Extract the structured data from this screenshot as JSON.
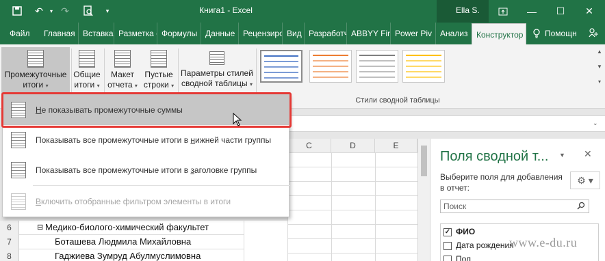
{
  "window": {
    "title": "Книга1  -  Excel",
    "user": "Ella S.",
    "icons": [
      "save-icon",
      "undo-icon",
      "redo-icon",
      "print-preview-icon",
      "customize-qat-icon",
      "minimize-icon",
      "maximize-icon",
      "close-icon"
    ]
  },
  "tabs": [
    {
      "label": "Файл"
    },
    {
      "label": "Главная"
    },
    {
      "label": "Вставка"
    },
    {
      "label": "Разметка с"
    },
    {
      "label": "Формулы"
    },
    {
      "label": "Данные"
    },
    {
      "label": "Рецензиро"
    },
    {
      "label": "Вид"
    },
    {
      "label": "Разработч"
    },
    {
      "label": "ABBYY Fin"
    },
    {
      "label": "Power Piv"
    },
    {
      "label": "Анализ"
    },
    {
      "label": "Конструктор",
      "active": true
    },
    {
      "label": "Помощн"
    }
  ],
  "ribbon": {
    "subtotals": {
      "line1": "Промежуточные",
      "line2": "итоги"
    },
    "grand_totals": {
      "line1": "Общие",
      "line2": "итоги"
    },
    "report_layout": {
      "line1": "Макет",
      "line2": "отчета"
    },
    "blank_rows": {
      "line1": "Пустые",
      "line2": "строки"
    },
    "style_options": {
      "line1": "Параметры стилей",
      "line2": "сводной таблицы"
    },
    "styles_group_label": "Стили сводной таблицы",
    "accent_colors": [
      "#4472c4",
      "#ed7d31",
      "#ffc000"
    ]
  },
  "menu": {
    "items": [
      {
        "pre": "",
        "u": "Н",
        "post": "е показывать промежуточные суммы",
        "highlighted": true
      },
      {
        "pre": "Показывать все промежуточные итоги в ",
        "u": "н",
        "post": "ижней части группы"
      },
      {
        "pre": "Показывать все промежуточные итоги в ",
        "u": "з",
        "post": "аголовке группы"
      },
      {
        "pre": "",
        "u": "В",
        "post": "ключить отобранные фильтром элементы в итоги",
        "disabled": true
      }
    ]
  },
  "grid": {
    "columns": [
      "C",
      "D",
      "E"
    ],
    "rows": [
      {
        "num": "6",
        "text": "Медико-биолого-химический факультет",
        "collapse": "⊟"
      },
      {
        "num": "7",
        "text": "Боташева Людмила Михайловна"
      },
      {
        "num": "8",
        "text": "Гаджиева Зумруд Абулмуслимовна"
      }
    ]
  },
  "pane": {
    "title": "Поля сводной т...",
    "hint": "Выберите поля для добавления в отчет:",
    "search_placeholder": "Поиск",
    "fields": [
      {
        "label": "ФИО",
        "checked": true
      },
      {
        "label": "Дата рождения",
        "checked": false
      },
      {
        "label": "Пол",
        "checked": false
      }
    ]
  },
  "watermark": "www.e-du.ru"
}
